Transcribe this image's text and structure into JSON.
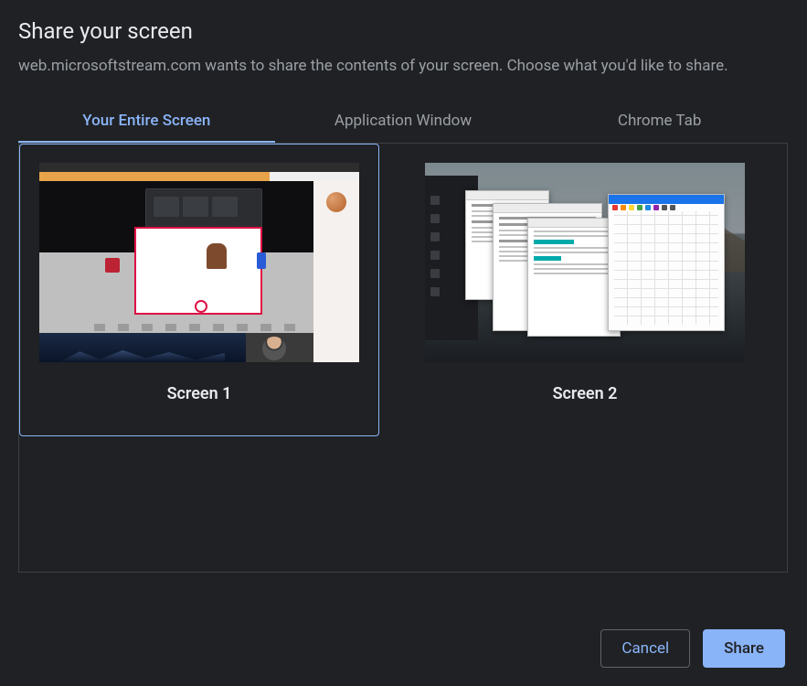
{
  "dialog": {
    "title": "Share your screen",
    "description": "web.microsoftstream.com wants to share the contents of your screen. Choose what you'd like to share."
  },
  "tabs": [
    {
      "label": "Your Entire Screen",
      "active": true
    },
    {
      "label": "Application Window",
      "active": false
    },
    {
      "label": "Chrome Tab",
      "active": false
    }
  ],
  "screens": [
    {
      "label": "Screen 1",
      "selected": true
    },
    {
      "label": "Screen 2",
      "selected": false
    }
  ],
  "buttons": {
    "cancel": "Cancel",
    "share": "Share"
  }
}
